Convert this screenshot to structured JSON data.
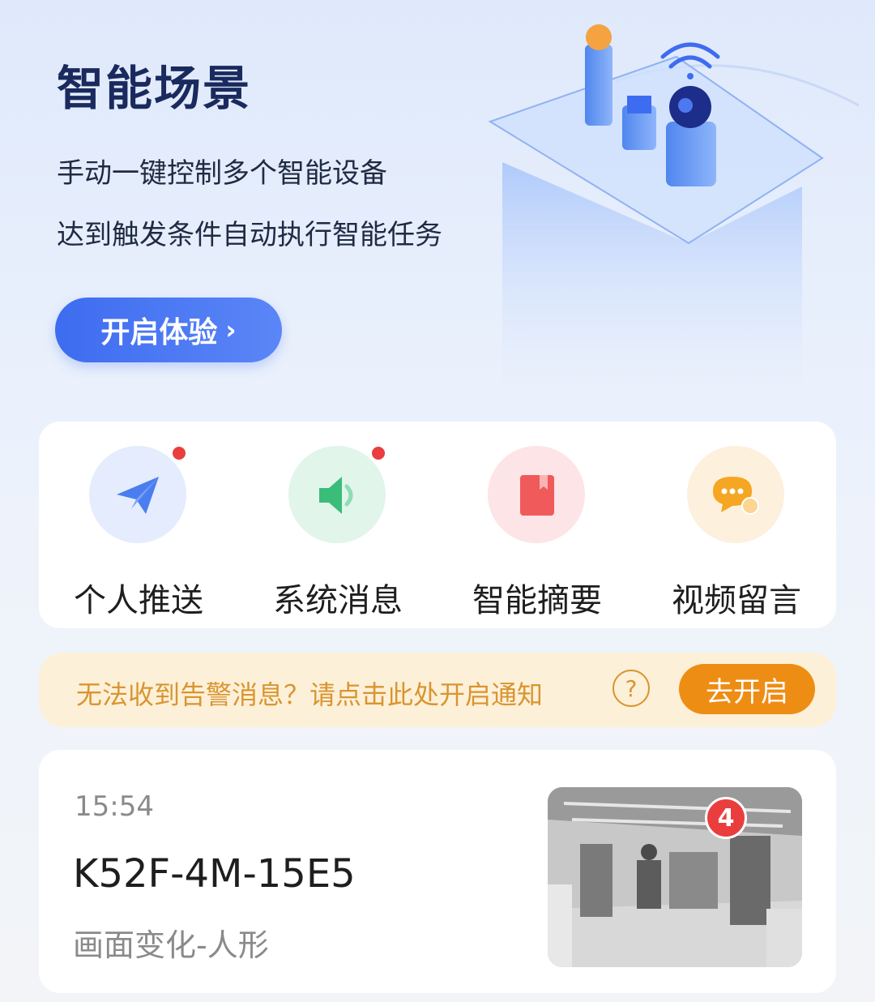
{
  "banner": {
    "title": "智能场景",
    "line1": "手动一键控制多个智能设备",
    "line2": "达到触发条件自动执行智能任务",
    "cta_label": "开启体验",
    "cta_chevron": "›"
  },
  "actions": [
    {
      "label": "个人推送",
      "icon": "paper-plane-icon",
      "color": "#4a7ef0",
      "has_dot": true
    },
    {
      "label": "系统消息",
      "icon": "speaker-icon",
      "color": "#3bbd7a",
      "has_dot": true
    },
    {
      "label": "智能摘要",
      "icon": "book-icon",
      "color": "#f05a5a",
      "has_dot": false
    },
    {
      "label": "视频留言",
      "icon": "chat-bubble-icon",
      "color": "#f5a623",
      "has_dot": false
    }
  ],
  "notice": {
    "text": "无法收到告警消息？请点击此处开启通知",
    "help_symbol": "?",
    "button_label": "去开启",
    "accent": "#ee8d14"
  },
  "event": {
    "time": "15:54",
    "device": "K52F-4M-15E5",
    "description": "画面变化-人形",
    "badge_count": "4"
  }
}
